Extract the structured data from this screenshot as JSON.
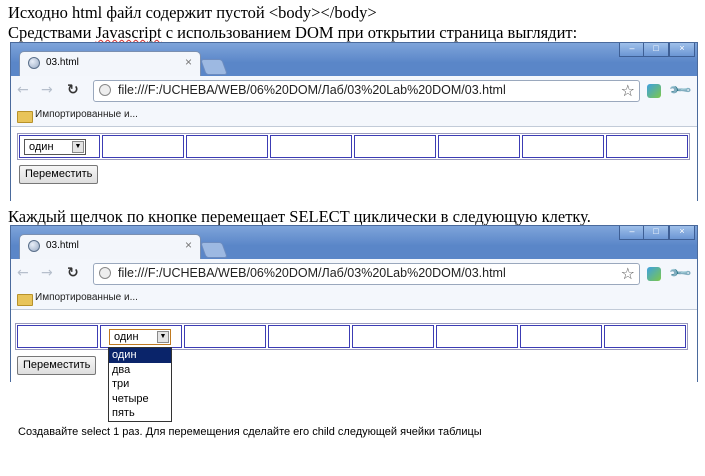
{
  "doc": {
    "line1": "Исходно html файл содержит пустой <body></body>",
    "line2_a": "Средствами ",
    "line2_b": "Javascript",
    "line2_c": " с использованием DOM при открытии страница выглядит:",
    "line3": "Каждый щелчок по кнопке перемещает SELECT циклически в следующую клетку.",
    "note": "Создавайте select 1 раз. Для перемещения сделайте его child следующей ячейки таблицы"
  },
  "browser": {
    "tab_title": "03.html",
    "tab_close": "×",
    "url": "file:///F:/UCHEBA/WEB/06%20DOM/Лаб/03%20Lab%20DOM/03.html",
    "bookmark": "Импортированные и...",
    "window_controls": {
      "minimize": "–",
      "maximize": "□",
      "close": "×"
    }
  },
  "page": {
    "select_value": "один",
    "button_label": "Переместить",
    "options": [
      "один",
      "два",
      "три",
      "четыре",
      "пять"
    ],
    "active_option": "один"
  },
  "icons": [
    "globe-icon",
    "back-arrow-icon",
    "forward-arrow-icon",
    "reload-icon",
    "page-icon",
    "star-icon",
    "extension-icon",
    "wrench-icon",
    "folder-icon"
  ],
  "colors": {
    "titlebar": "#5a86c8",
    "cell_border": "#3c3cb4",
    "option_highlight": "#0a246a"
  }
}
